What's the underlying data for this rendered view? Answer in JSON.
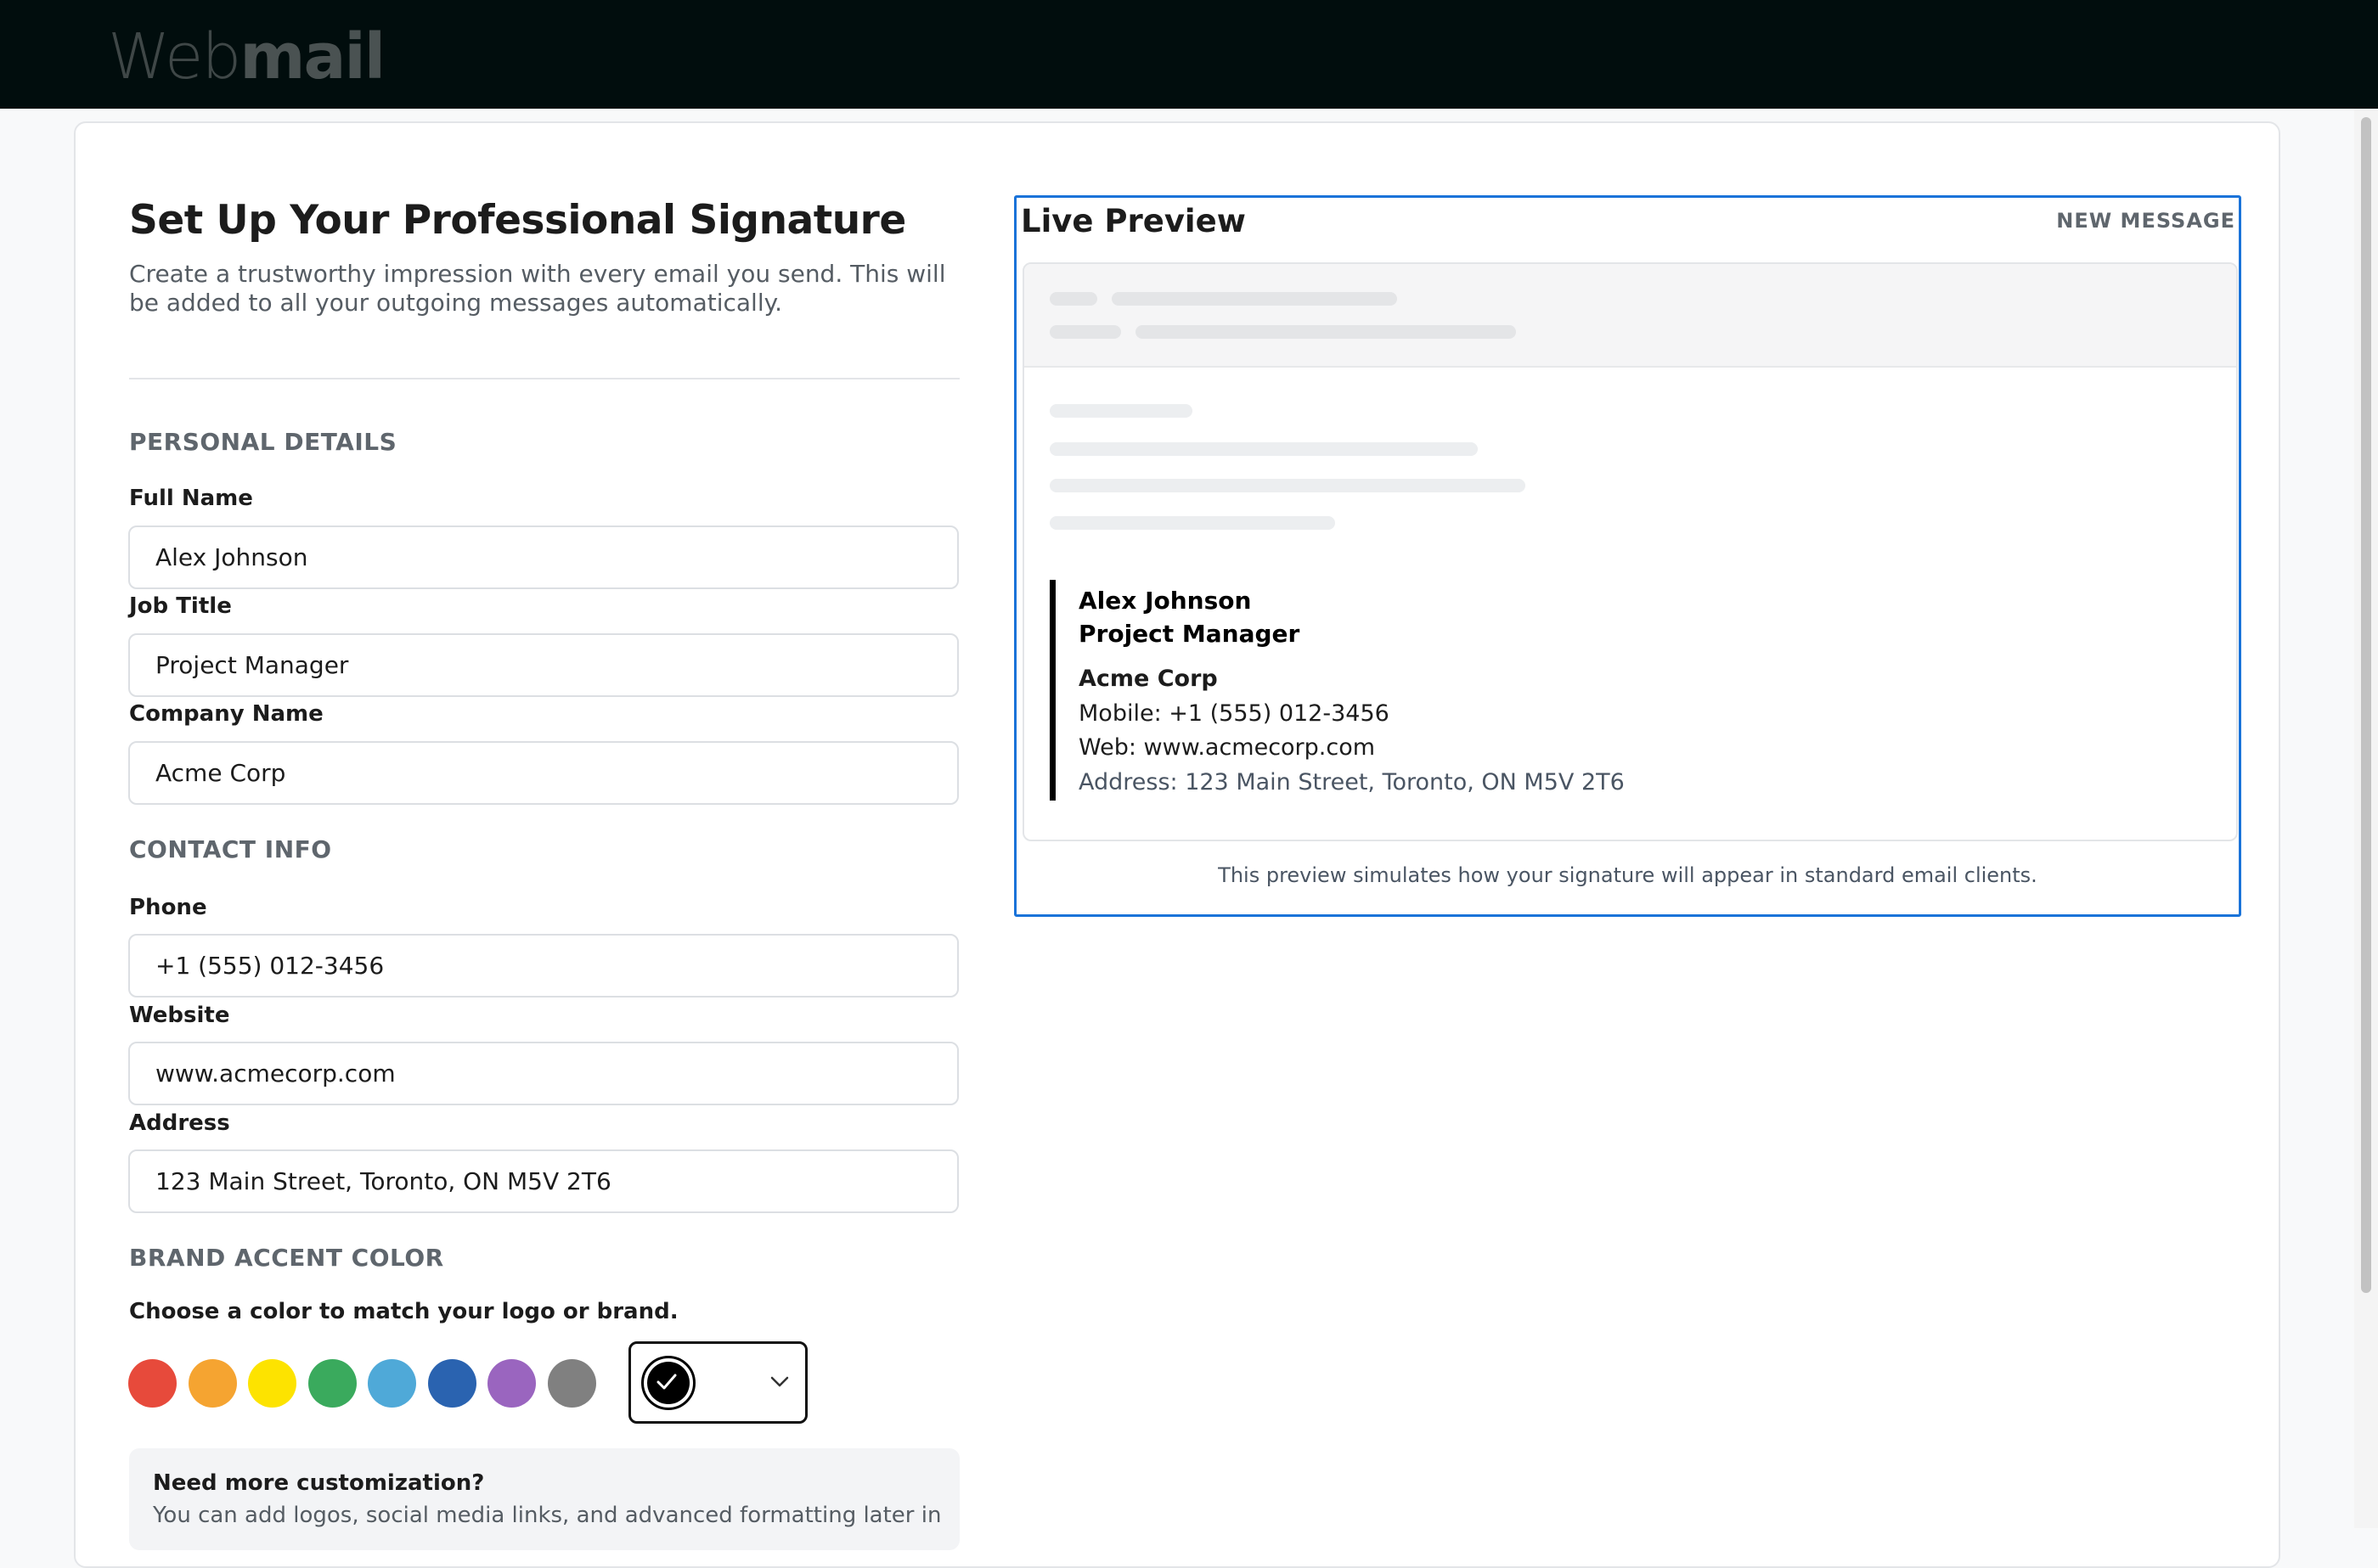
{
  "app": {
    "logo_light": "Web",
    "logo_bold": "mail"
  },
  "form": {
    "title": "Set Up Your Professional Signature",
    "subtitle": "Create a trustworthy impression with every email you send. This will be added to all your outgoing messages automatically.",
    "sections": {
      "personal": "PERSONAL DETAILS",
      "contact": "CONTACT INFO",
      "brand": "BRAND ACCENT COLOR"
    },
    "fields": {
      "full_name": {
        "label": "Full Name",
        "value": "Alex Johnson"
      },
      "job_title": {
        "label": "Job Title",
        "value": "Project Manager"
      },
      "company": {
        "label": "Company Name",
        "value": "Acme Corp"
      },
      "phone": {
        "label": "Phone",
        "value": "+1 (555) 012-3456"
      },
      "website": {
        "label": "Website",
        "value": "www.acmecorp.com"
      },
      "address": {
        "label": "Address",
        "value": "123 Main Street, Toronto, ON M5V 2T6"
      }
    },
    "brand_hint": "Choose a color to match your logo or brand.",
    "swatches": [
      "#e74a3b",
      "#f5a431",
      "#fde300",
      "#3aaa5d",
      "#4fa9d8",
      "#2a63b0",
      "#9a65bf",
      "#808080"
    ],
    "selected_color": "#000000",
    "info": {
      "title": "Need more customization?",
      "text": "You can add logos, social media links, and advanced formatting later in"
    }
  },
  "preview": {
    "title": "Live Preview",
    "tag": "NEW MESSAGE",
    "signature": {
      "name": "Alex Johnson",
      "job": "Project Manager",
      "company": "Acme Corp",
      "phone": "Mobile: +1 (555) 012-3456",
      "web": "Web: www.acmecorp.com",
      "address": "Address: 123 Main Street, Toronto, ON M5V 2T6"
    },
    "note": "This preview simulates how your signature will appear in standard email clients."
  }
}
